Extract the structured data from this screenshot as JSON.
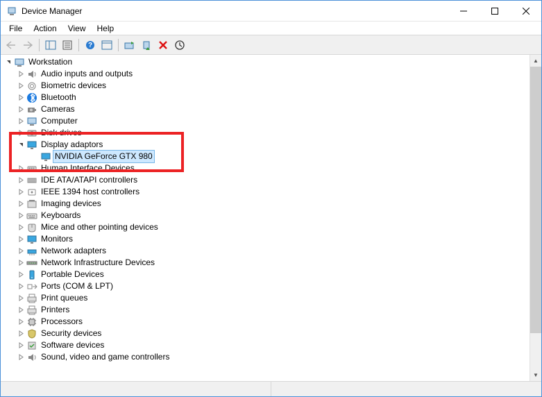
{
  "window": {
    "title": "Device Manager"
  },
  "menubar": {
    "file": "File",
    "action": "Action",
    "view": "View",
    "help": "Help"
  },
  "tree": {
    "root": "Workstation",
    "items": [
      {
        "label": "Audio inputs and outputs",
        "icon": "audio"
      },
      {
        "label": "Biometric devices",
        "icon": "biometric"
      },
      {
        "label": "Bluetooth",
        "icon": "bluetooth"
      },
      {
        "label": "Cameras",
        "icon": "camera"
      },
      {
        "label": "Computer",
        "icon": "computer"
      },
      {
        "label": "Disk drives",
        "icon": "disk"
      },
      {
        "label": "Display adaptors",
        "icon": "display",
        "expanded": true,
        "children": [
          {
            "label": "NVIDIA GeForce GTX 980",
            "icon": "display",
            "selected": true
          }
        ]
      },
      {
        "label": "Human Interface Devices",
        "icon": "hid"
      },
      {
        "label": "IDE ATA/ATAPI controllers",
        "icon": "ide"
      },
      {
        "label": "IEEE 1394 host controllers",
        "icon": "ieee1394"
      },
      {
        "label": "Imaging devices",
        "icon": "imaging"
      },
      {
        "label": "Keyboards",
        "icon": "keyboard"
      },
      {
        "label": "Mice and other pointing devices",
        "icon": "mouse"
      },
      {
        "label": "Monitors",
        "icon": "monitor"
      },
      {
        "label": "Network adapters",
        "icon": "network"
      },
      {
        "label": "Network Infrastructure Devices",
        "icon": "netinfra"
      },
      {
        "label": "Portable Devices",
        "icon": "portable"
      },
      {
        "label": "Ports (COM & LPT)",
        "icon": "ports"
      },
      {
        "label": "Print queues",
        "icon": "printqueue"
      },
      {
        "label": "Printers",
        "icon": "printer"
      },
      {
        "label": "Processors",
        "icon": "processor"
      },
      {
        "label": "Security devices",
        "icon": "security"
      },
      {
        "label": "Software devices",
        "icon": "software"
      },
      {
        "label": "Sound, video and game controllers",
        "icon": "sound"
      }
    ]
  }
}
